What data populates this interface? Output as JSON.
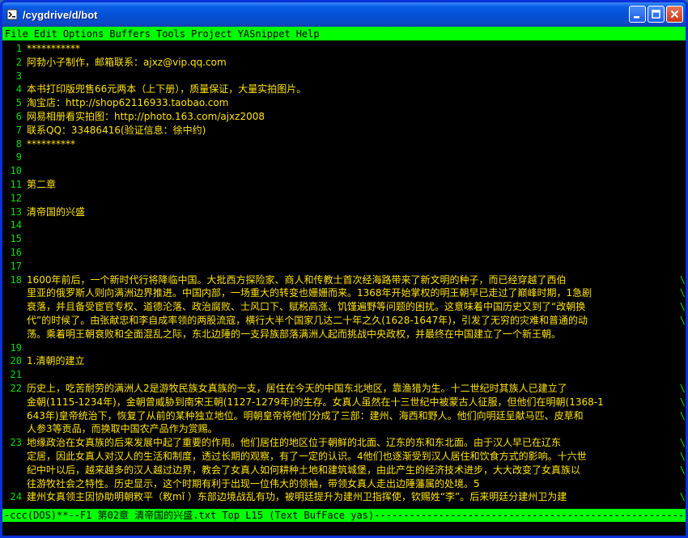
{
  "window": {
    "title": "/cygdrive/d/bot",
    "icon": "cygwin-terminal-icon"
  },
  "menu": {
    "items": [
      "File",
      "Edit",
      "Options",
      "Buffers",
      "Tools",
      "Project",
      "YASnippet",
      "Help"
    ]
  },
  "editor": {
    "lines": [
      {
        "num": "1",
        "text": "***********",
        "wrap": false
      },
      {
        "num": "2",
        "text": "阿勃小子制作，邮箱联系：ajxz@vip.qq.com",
        "wrap": false
      },
      {
        "num": "3",
        "text": "",
        "wrap": false
      },
      {
        "num": "4",
        "text": "本书打印版兜售66元两本（上下册），质量保证，大量实拍图片。",
        "wrap": false
      },
      {
        "num": "5",
        "text": "淘宝店：http://shop62116933.taobao.com",
        "wrap": false
      },
      {
        "num": "6",
        "text": "网易相册看实拍图：http://photo.163.com/ajxz2008",
        "wrap": false
      },
      {
        "num": "7",
        "text": "联系QQ：33486416(验证信息：徐中约)",
        "wrap": false
      },
      {
        "num": "8",
        "text": "**********",
        "wrap": false
      },
      {
        "num": "9",
        "text": "",
        "wrap": false
      },
      {
        "num": "10",
        "text": "",
        "wrap": false
      },
      {
        "num": "11",
        "text": "第二章",
        "wrap": false
      },
      {
        "num": "12",
        "text": "",
        "wrap": false
      },
      {
        "num": "13",
        "text": "清帝国的兴盛",
        "wrap": false
      },
      {
        "num": "14",
        "text": "",
        "wrap": false
      },
      {
        "num": "15",
        "text": "",
        "wrap": false
      },
      {
        "num": "16",
        "text": "",
        "wrap": false
      },
      {
        "num": "17",
        "text": "",
        "wrap": false
      },
      {
        "num": "18",
        "text": "    1600年前后，一个新时代行将降临中国。大批西方探险家、商人和传教士首次经海路带来了新文明的种子，而已经穿越了西伯",
        "wrap": true
      },
      {
        "num": "",
        "text": "里亚的俄罗斯人则向满洲边界推进。中国内部，一场重大的转变也姗姗而来。1368年开始掌权的明王朝早已走过了巅峰时期，1急剧",
        "wrap": true
      },
      {
        "num": "",
        "text": "衰落，并且备受宦官专权、道德沦落、政治腐败、士风口下、赋税高涨、饥馑遍野等问题的困扰。这意味着中国历史又到了“改朝换",
        "wrap": true
      },
      {
        "num": "",
        "text": "代”的时候了。由张献忠和李自成率领的两股流寇，横行大半个国家几达二十年之久(1628-1647年)，引发了无穷的灾难和普通的动",
        "wrap": true
      },
      {
        "num": "",
        "text": "荡。乘着明王朝衰败和全面混乱之际，东北边陲的一支异族部落满洲人起而挑战中央政权，并最终在中国建立了一个新王朝。",
        "wrap": false
      },
      {
        "num": "19",
        "text": "",
        "wrap": false
      },
      {
        "num": "20",
        "text": "1.清朝的建立",
        "wrap": false
      },
      {
        "num": "21",
        "text": "",
        "wrap": false
      },
      {
        "num": "22",
        "text": "    历史上，吃苦耐劳的满洲人2是游牧民族女真族的一支，居住在今天的中国东北地区，靠渔猎为生。十二世纪时其族人已建立了",
        "wrap": true
      },
      {
        "num": "",
        "text": "金朝(1115-1234年)，金朝曾威胁到南宋王朝(1127-1279年)的生存。女真人虽然在十三世纪中被蒙古人征服，但他们在明朝(1368-1",
        "wrap": true
      },
      {
        "num": "",
        "text": "643年)皇帝统治下，恢复了从前的某种独立地位。明朝皇帝将他们分成了三部：建州、海西和野人。他们向明廷呈献马匹、皮草和",
        "wrap": true
      },
      {
        "num": "",
        "text": "人参3等贡品，而换取中国农产品作为赏赐。",
        "wrap": false
      },
      {
        "num": "23",
        "text": "    地缘政治在女真族的后来发展中起了重要的作用。他们居住的地区位于朝鲜的北面、辽东的东和东北面。由于汉人早已在辽东",
        "wrap": true
      },
      {
        "num": "",
        "text": "定居，因此女真人对汉人的生活和制度，透过长期的观察，有了一定的认识。4他们也逐渐受到汉人居住和饮食方式的影响。十六世",
        "wrap": true
      },
      {
        "num": "",
        "text": "纪中叶以后，越来越多的汉人越过边界，教会了女真人如何耕种土地和建筑城堡，由此产生的经济技术进步，大大改变了女真族以",
        "wrap": true
      },
      {
        "num": "",
        "text": "往游牧社会之特性。历史显示，这个时期有利于出现一位伟大的领袖，带领女真人走出边陲藩属的处境。5",
        "wrap": false
      },
      {
        "num": "24",
        "text": "    建州女真领主因协助明朝敉平（敉mǐ ）东部边境战乱有功，被明廷提升为建州卫指挥使，钦赐姓“李”。后来明廷分建州卫为建",
        "wrap": true
      }
    ]
  },
  "modeline": {
    "text": "-ccc(DOS)**--F1  第02章 清帝国的兴盛.txt   Top L15    (Text BufFace yas)--------------------------------------------------------"
  },
  "colors": {
    "menubar_bg": "#00ff00",
    "text": "#ffe400",
    "line_numbers": "#00e000",
    "editor_bg": "#000000",
    "titlebar": "#0a5ce8"
  }
}
